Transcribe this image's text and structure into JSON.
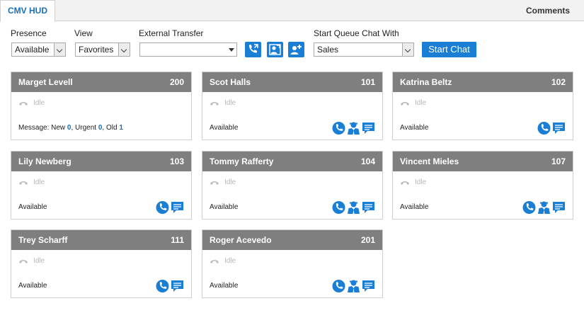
{
  "tabs": {
    "active": "CMV HUD",
    "right": "Comments"
  },
  "controls": {
    "presence_label": "Presence",
    "presence_value": "Available",
    "view_label": "View",
    "view_value": "Favorites",
    "transfer_label": "External Transfer",
    "transfer_value": "",
    "queue_label": "Start Queue Chat With",
    "queue_value": "Sales",
    "start_chat": "Start Chat"
  },
  "colors": {
    "accent": "#1a7fd4",
    "header": "#7f7f7f",
    "link": "#1a6fb5"
  },
  "cards": [
    {
      "name": "Marget Levell",
      "ext": "200",
      "status": "Idle",
      "message_prefix": "Message: New ",
      "new": "0",
      "sep1": ", Urgent ",
      "urgent": "0",
      "sep2": ", Old ",
      "old": "1"
    },
    {
      "name": "Scot Halls",
      "ext": "101",
      "status": "Idle",
      "presence": "Available"
    },
    {
      "name": "Katrina Beltz",
      "ext": "102",
      "status": "Idle",
      "presence": "Available"
    },
    {
      "name": "Lily Newberg",
      "ext": "103",
      "status": "Idle",
      "presence": "Available"
    },
    {
      "name": "Tommy Rafferty",
      "ext": "104",
      "status": "Idle",
      "presence": "Available"
    },
    {
      "name": "Vincent Mieles",
      "ext": "107",
      "status": "Idle",
      "presence": "Available"
    },
    {
      "name": "Trey Scharff",
      "ext": "111",
      "status": "Idle",
      "presence": "Available"
    },
    {
      "name": "Roger Acevedo",
      "ext": "201",
      "status": "Idle",
      "presence": "Available"
    }
  ]
}
